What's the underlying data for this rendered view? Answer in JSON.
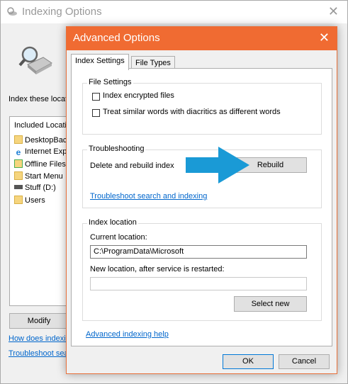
{
  "background_window": {
    "title": "Indexing Options",
    "index_these_label": "Index these locati",
    "included_header": "Included Locatio",
    "locations": [
      {
        "label": "DesktopBack",
        "icon": "folder-icon"
      },
      {
        "label": "Internet Exp",
        "icon": "internet-explorer-icon"
      },
      {
        "label": "Offline Files",
        "icon": "offline-files-icon"
      },
      {
        "label": "Start Menu",
        "icon": "folder-icon"
      },
      {
        "label": "Stuff (D:)",
        "icon": "drive-icon"
      },
      {
        "label": "Users",
        "icon": "folder-icon"
      }
    ],
    "modify_button": "Modify",
    "how_link": "How does indexin",
    "troubleshoot_link": "Troubleshoot sea"
  },
  "dialog": {
    "title": "Advanced Options",
    "tabs": [
      "Index Settings",
      "File Types"
    ],
    "file_settings": {
      "heading": "File Settings",
      "encrypt_label": "Index encrypted files",
      "diacritics_label": "Treat similar words with diacritics as different words",
      "encrypt_checked": false,
      "diacritics_checked": false
    },
    "troubleshooting": {
      "heading": "Troubleshooting",
      "delete_label": "Delete and rebuild index",
      "rebuild_button": "Rebuild",
      "troubleshoot_link": "Troubleshoot search and indexing"
    },
    "index_location": {
      "heading": "Index location",
      "current_label": "Current location:",
      "current_value": "C:\\ProgramData\\Microsoft",
      "new_label": "New location, after service is restarted:",
      "new_value": "",
      "select_new_button": "Select new"
    },
    "help_link": "Advanced indexing help",
    "ok_button": "OK",
    "cancel_button": "Cancel"
  },
  "colors": {
    "dialog_title": "#f06b32",
    "arrow": "#1a9ad6",
    "link": "#0066cc"
  }
}
